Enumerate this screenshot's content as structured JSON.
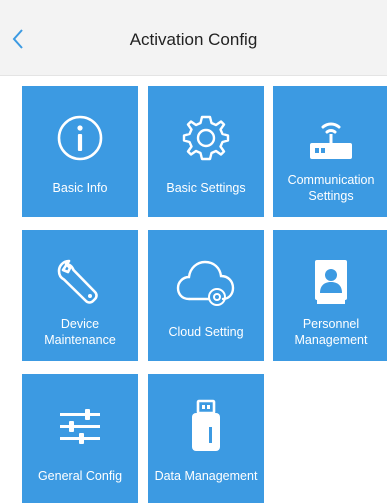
{
  "header": {
    "title": "Activation Config",
    "back_icon": "chevron-left-icon"
  },
  "colors": {
    "tile_background": "#3c9ae2",
    "header_background": "#f3f3f3",
    "accent": "#3c9ae2",
    "icon_color": "#ffffff"
  },
  "tiles": [
    {
      "label": "Basic Info",
      "icon": "info-icon"
    },
    {
      "label": "Basic Settings",
      "icon": "gear-icon"
    },
    {
      "label": "Communication\nSettings",
      "icon": "router-icon"
    },
    {
      "label": "Device\nMaintenance",
      "icon": "wrench-icon"
    },
    {
      "label": "Cloud Setting",
      "icon": "cloud-gear-icon"
    },
    {
      "label": "Personnel\nManagement",
      "icon": "contact-book-icon"
    },
    {
      "label": "General Config",
      "icon": "sliders-icon"
    },
    {
      "label": "Data Management",
      "icon": "usb-drive-icon"
    }
  ]
}
